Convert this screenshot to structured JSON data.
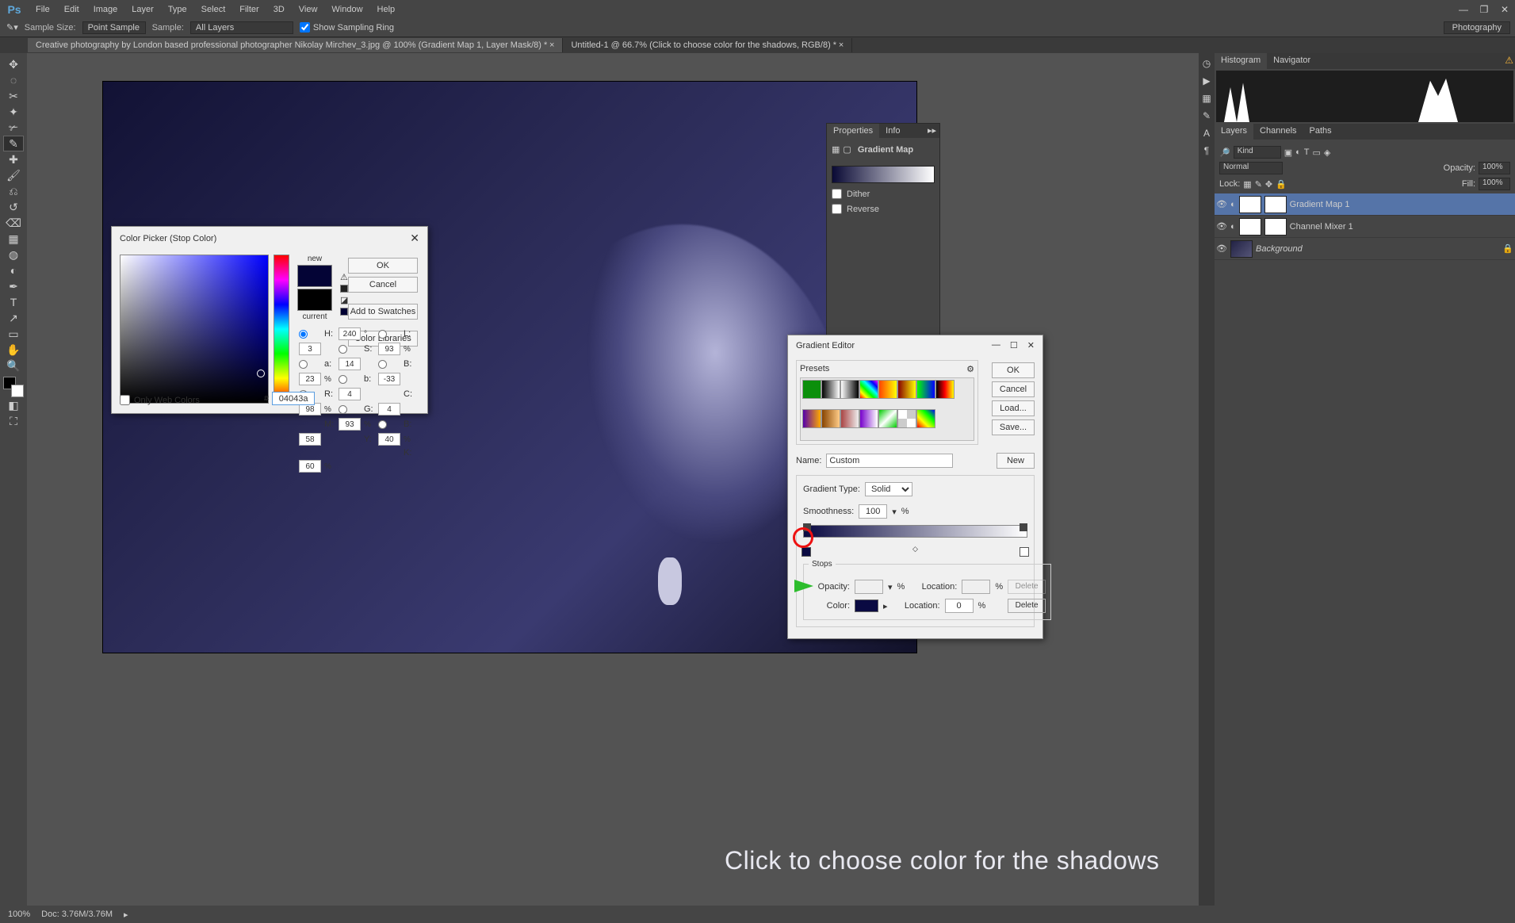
{
  "menu": [
    "File",
    "Edit",
    "Image",
    "Layer",
    "Type",
    "Select",
    "Filter",
    "3D",
    "View",
    "Window",
    "Help"
  ],
  "options": {
    "sample_size_label": "Sample Size:",
    "sample_size": "Point Sample",
    "sample_label": "Sample:",
    "sample": "All Layers",
    "ring": "Show Sampling Ring",
    "workspace": "Photography"
  },
  "tabs": [
    "Creative photography by London based professional photographer Nikolay Mirchev_3.jpg @ 100% (Gradient Map 1, Layer Mask/8) *",
    "Untitled-1 @ 66.7% (Click to choose color for the shadows, RGB/8) *"
  ],
  "panels": {
    "histogram_tabs": [
      "Histogram",
      "Navigator"
    ],
    "lcp_tabs": [
      "Layers",
      "Channels",
      "Paths"
    ],
    "kind": "Kind",
    "blend": "Normal",
    "opacity_lbl": "Opacity:",
    "opacity": "100%",
    "lock_lbl": "Lock:",
    "fill_lbl": "Fill:",
    "fill": "100%",
    "layers": [
      {
        "name": "Gradient Map 1",
        "sel": true
      },
      {
        "name": "Channel Mixer 1",
        "sel": false
      },
      {
        "name": "Background",
        "sel": false,
        "italic": true
      }
    ]
  },
  "props": {
    "tabs": [
      "Properties",
      "Info"
    ],
    "title": "Gradient Map",
    "dither": "Dither",
    "reverse": "Reverse"
  },
  "gdlg": {
    "title": "Gradient Editor",
    "presets": "Presets",
    "ok": "OK",
    "cancel": "Cancel",
    "load": "Load...",
    "save": "Save...",
    "new": "New",
    "name_lbl": "Name:",
    "name": "Custom",
    "type_lbl": "Gradient Type:",
    "type": "Solid",
    "smooth_lbl": "Smoothness:",
    "smooth": "100",
    "pct": "%",
    "stops": "Stops",
    "opacity_lbl": "Opacity:",
    "loc_lbl": "Location:",
    "loc": "0",
    "color_lbl": "Color:",
    "delete": "Delete"
  },
  "cp": {
    "title": "Color Picker (Stop Color)",
    "new": "new",
    "current": "current",
    "ok": "OK",
    "cancel": "Cancel",
    "add": "Add to Swatches",
    "lib": "Color Libraries",
    "owc": "Only Web Colors",
    "hex_lbl": "#",
    "hex": "04043a",
    "vals": {
      "H": "240",
      "H_u": "°",
      "S": "93",
      "S_u": "%",
      "Bv": "23",
      "Bv_u": "%",
      "R": "4",
      "G": "4",
      "Bl": "58",
      "L": "3",
      "a": "14",
      "b": "-33",
      "C": "98",
      "M": "93",
      "Y": "40",
      "K": "60"
    }
  },
  "status": {
    "zoom": "100%",
    "doc": "Doc: 3.76M/3.76M"
  },
  "caption": "Click to choose color for the shadows"
}
